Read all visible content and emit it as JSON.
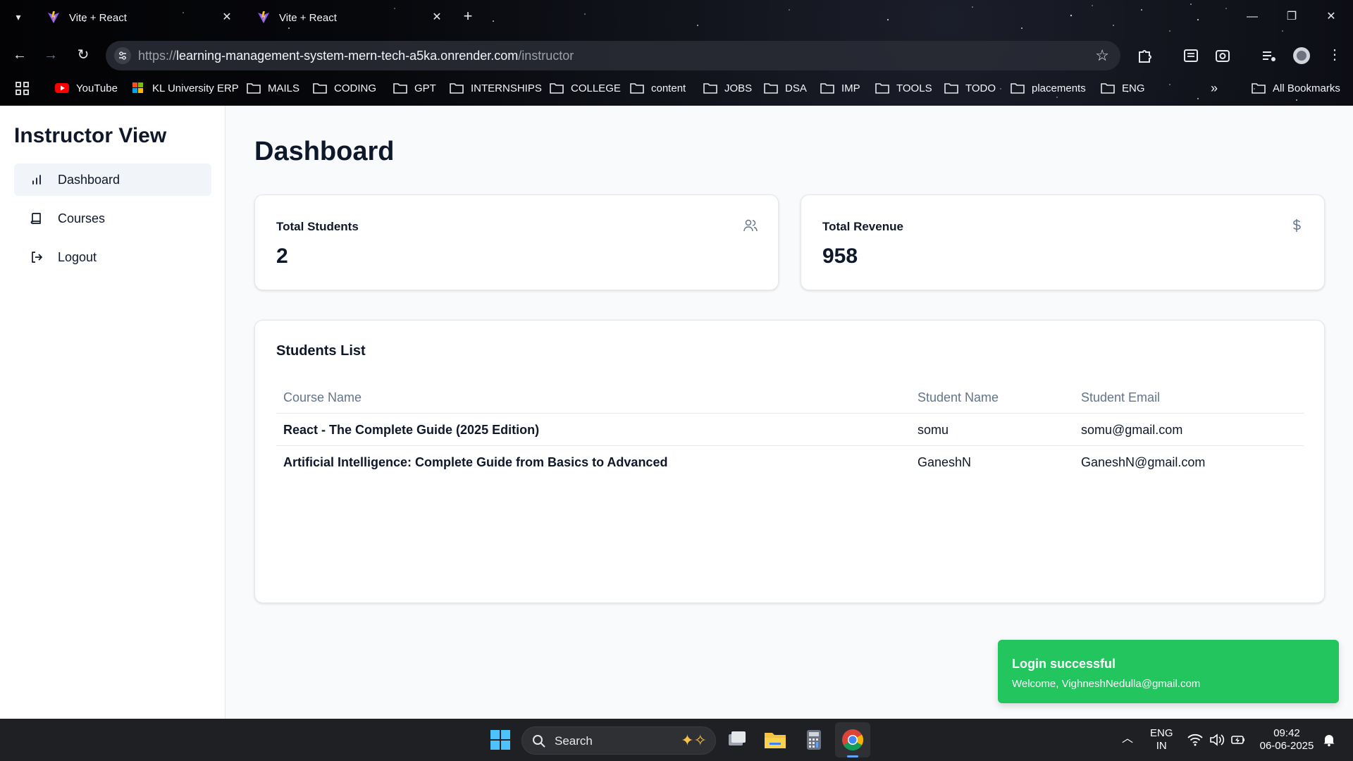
{
  "browser": {
    "tabs": [
      {
        "title": "Vite + React"
      },
      {
        "title": "Vite + React"
      }
    ],
    "url_scheme": "https://",
    "url_host": "learning-management-system-mern-tech-a5ka.onrender.com",
    "url_path": "/instructor",
    "bookmarks": [
      {
        "label": "YouTube",
        "icon": "youtube-icon"
      },
      {
        "label": "KL University ERP",
        "icon": "kl-erp-icon"
      },
      {
        "label": "MAILS",
        "icon": "folder-icon"
      },
      {
        "label": "CODING",
        "icon": "folder-icon"
      },
      {
        "label": "GPT",
        "icon": "folder-icon"
      },
      {
        "label": "INTERNSHIPS",
        "icon": "folder-icon"
      },
      {
        "label": "COLLEGE",
        "icon": "folder-icon"
      },
      {
        "label": "content",
        "icon": "folder-icon"
      },
      {
        "label": "JOBS",
        "icon": "folder-icon"
      },
      {
        "label": "DSA",
        "icon": "folder-icon"
      },
      {
        "label": "IMP",
        "icon": "folder-icon"
      },
      {
        "label": "TOOLS",
        "icon": "folder-icon"
      },
      {
        "label": "TODO",
        "icon": "folder-icon"
      },
      {
        "label": "placements",
        "icon": "folder-icon"
      },
      {
        "label": "ENG",
        "icon": "folder-icon"
      }
    ],
    "more_bookmarks": "»",
    "all_bookmarks": "All Bookmarks"
  },
  "sidebar": {
    "title": "Instructor View",
    "items": [
      {
        "label": "Dashboard",
        "icon": "bar-chart-icon",
        "active": true
      },
      {
        "label": "Courses",
        "icon": "book-icon",
        "active": false
      },
      {
        "label": "Logout",
        "icon": "logout-icon",
        "active": false
      }
    ]
  },
  "main": {
    "title": "Dashboard",
    "stats": [
      {
        "label": "Total Students",
        "value": "2",
        "icon": "users-icon"
      },
      {
        "label": "Total Revenue",
        "value": "958",
        "icon": "dollar-icon"
      }
    ],
    "students_list": {
      "title": "Students List",
      "columns": [
        "Course Name",
        "Student Name",
        "Student Email"
      ],
      "rows": [
        [
          "React - The Complete Guide (2025 Edition)",
          "somu",
          "somu@gmail.com"
        ],
        [
          "Artificial Intelligence: Complete Guide from Basics to Advanced",
          "GaneshN",
          "GaneshN@gmail.com"
        ]
      ]
    }
  },
  "toast": {
    "title": "Login successful",
    "message": "Welcome, VighneshNedulla@gmail.com",
    "color": "#22c55e"
  },
  "taskbar": {
    "search_label": "Search",
    "lang_top": "ENG",
    "lang_bottom": "IN",
    "time": "09:42",
    "date": "06-06-2025"
  }
}
